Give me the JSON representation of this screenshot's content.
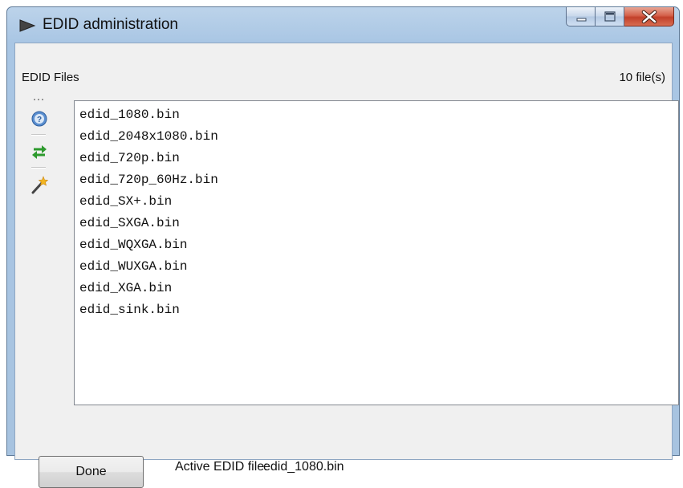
{
  "window": {
    "title": "EDID administration",
    "icon": "play-arrow-icon",
    "caption_buttons": [
      "minimize-icon",
      "maximize-icon",
      "close-icon"
    ]
  },
  "files_panel": {
    "label": "EDID Files",
    "count": "10 file(s)",
    "toolbar": [
      "help-icon",
      "refresh-icon",
      "magic-wand-icon"
    ],
    "files": [
      "edid_1080.bin",
      "edid_2048x1080.bin",
      "edid_720p.bin",
      "edid_720p_60Hz.bin",
      "edid_SX+.bin",
      "edid_SXGA.bin",
      "edid_WQXGA.bin",
      "edid_WUXGA.bin",
      "edid_XGA.bin",
      "edid_sink.bin"
    ]
  },
  "footer": {
    "done_label": "Done",
    "active_label": "Active EDID file:",
    "active_value": "edid_1080.bin"
  },
  "colors": {
    "frame": "#a9c6e4",
    "close_button": "#c2402a",
    "client_bg": "#f0f0f0"
  }
}
